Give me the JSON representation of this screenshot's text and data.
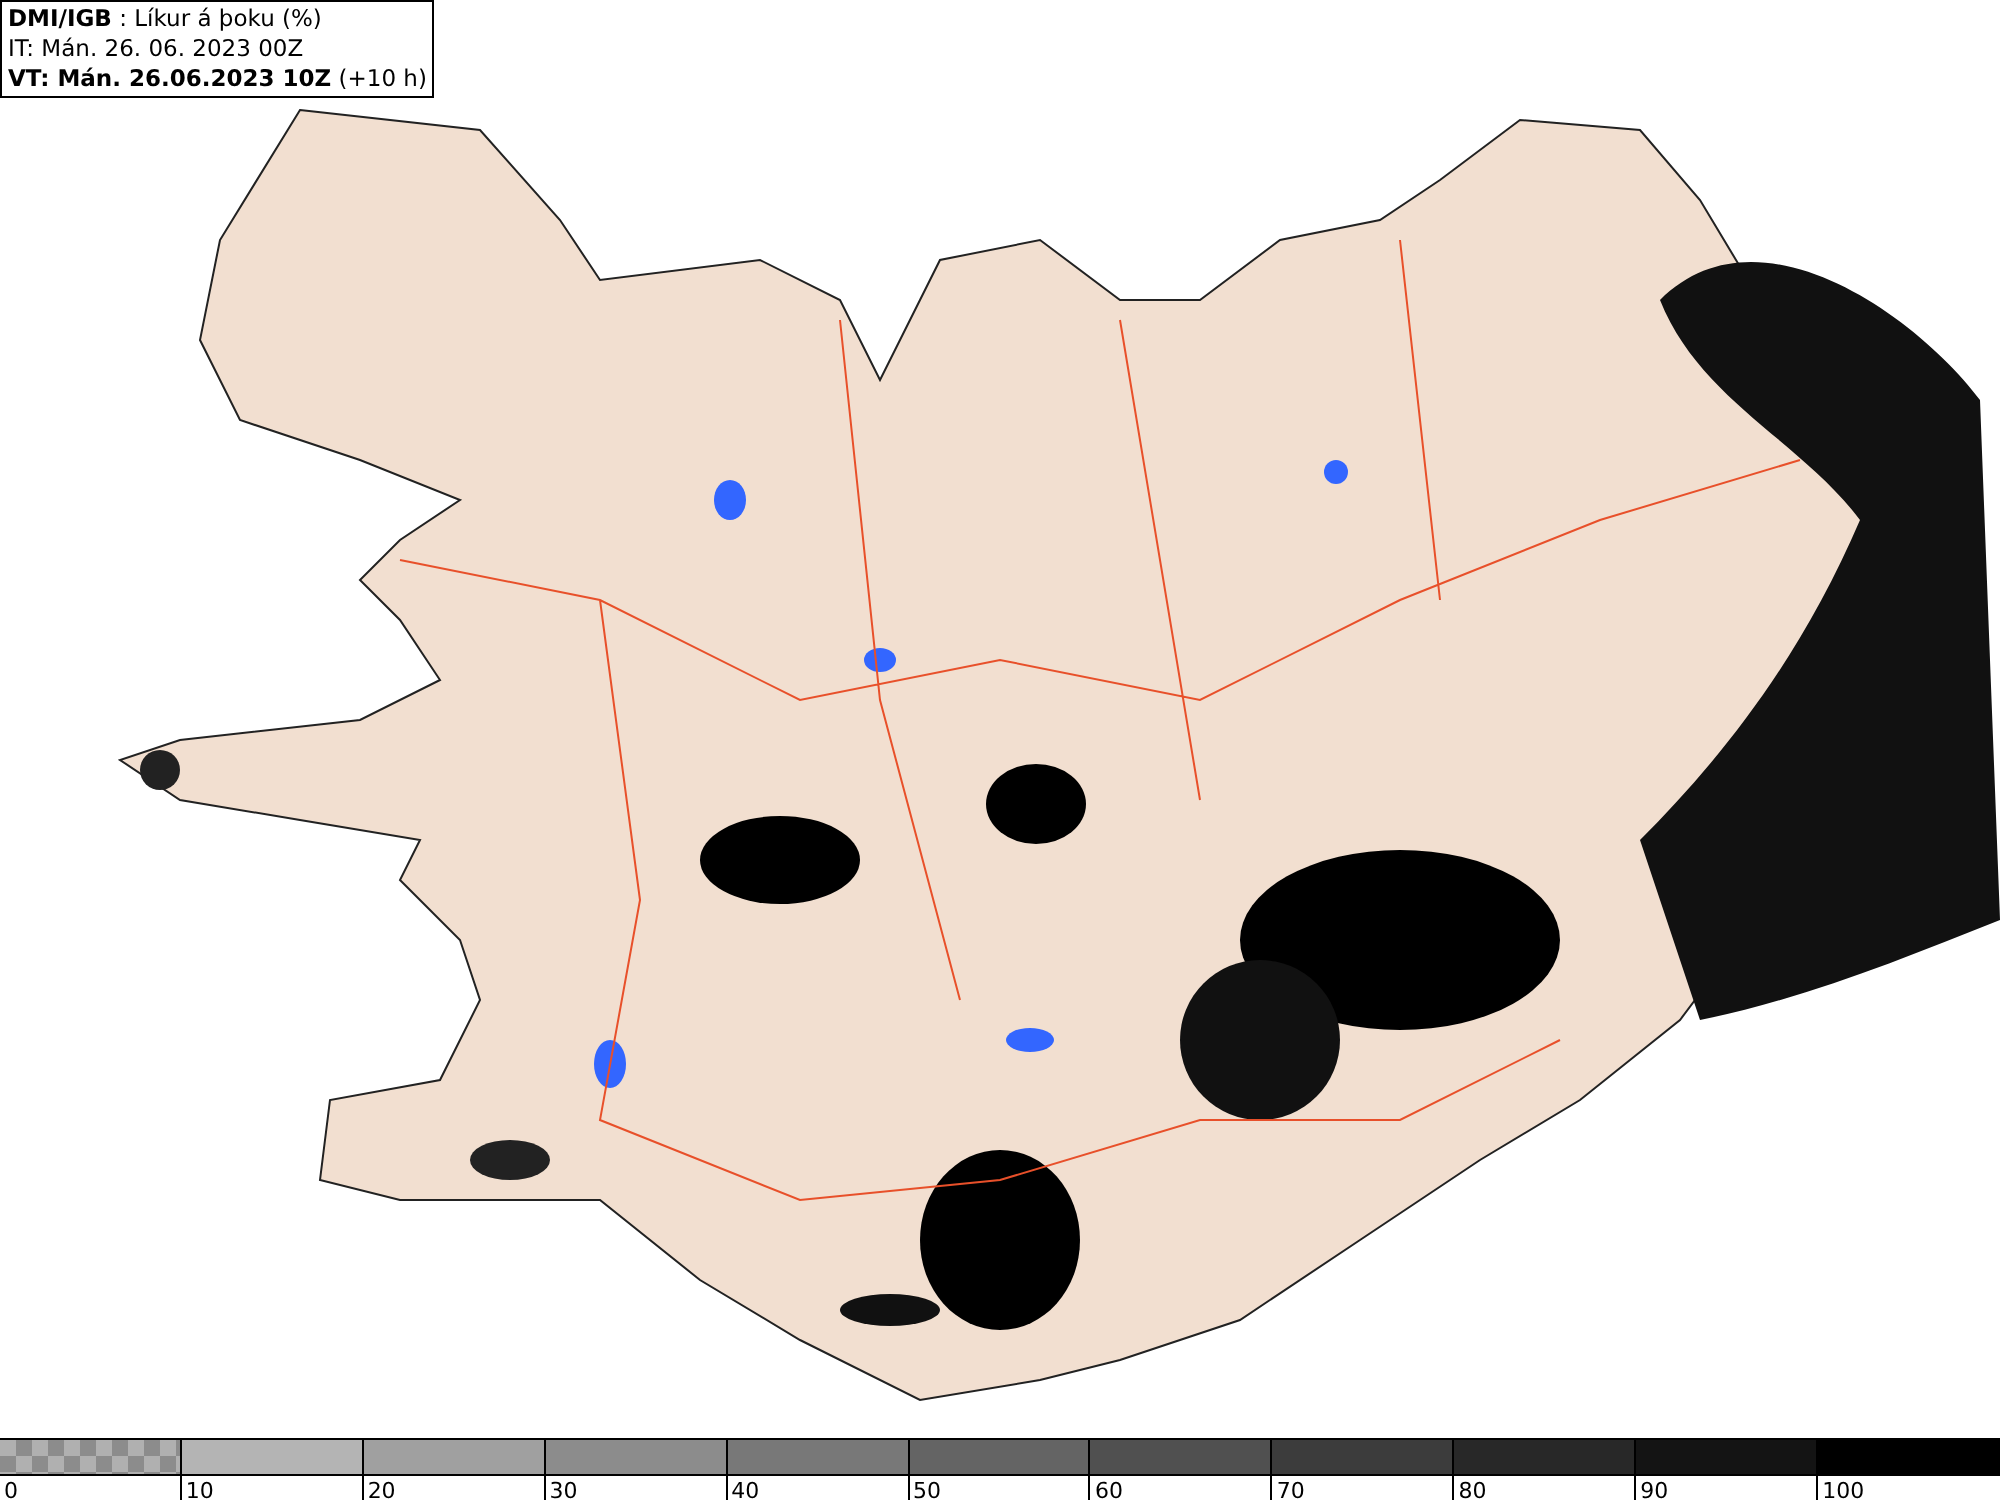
{
  "header": {
    "lines": [
      "**DMI/IGB** : Líkur á þoku (%)",
      "IT: Mán. 26. 06. 2023 00Z",
      "**VT: Mán. 26.06.2023 10Z** (+10 h)"
    ]
  },
  "legend": {
    "items": [
      {
        "label": "0",
        "kind": "checker",
        "color": "#8c8c8c"
      },
      {
        "label": "10",
        "kind": "solid",
        "color": "#b4b4b4"
      },
      {
        "label": "20",
        "kind": "solid",
        "color": "#a0a0a0"
      },
      {
        "label": "30",
        "kind": "solid",
        "color": "#8c8c8c"
      },
      {
        "label": "40",
        "kind": "solid",
        "color": "#787878"
      },
      {
        "label": "50",
        "kind": "solid",
        "color": "#646464"
      },
      {
        "label": "60",
        "kind": "solid",
        "color": "#505050"
      },
      {
        "label": "70",
        "kind": "solid",
        "color": "#3c3c3c"
      },
      {
        "label": "80",
        "kind": "solid",
        "color": "#282828"
      },
      {
        "label": "90",
        "kind": "solid",
        "color": "#141414"
      },
      {
        "label": "100",
        "kind": "solid",
        "color": "#000000"
      }
    ]
  }
}
